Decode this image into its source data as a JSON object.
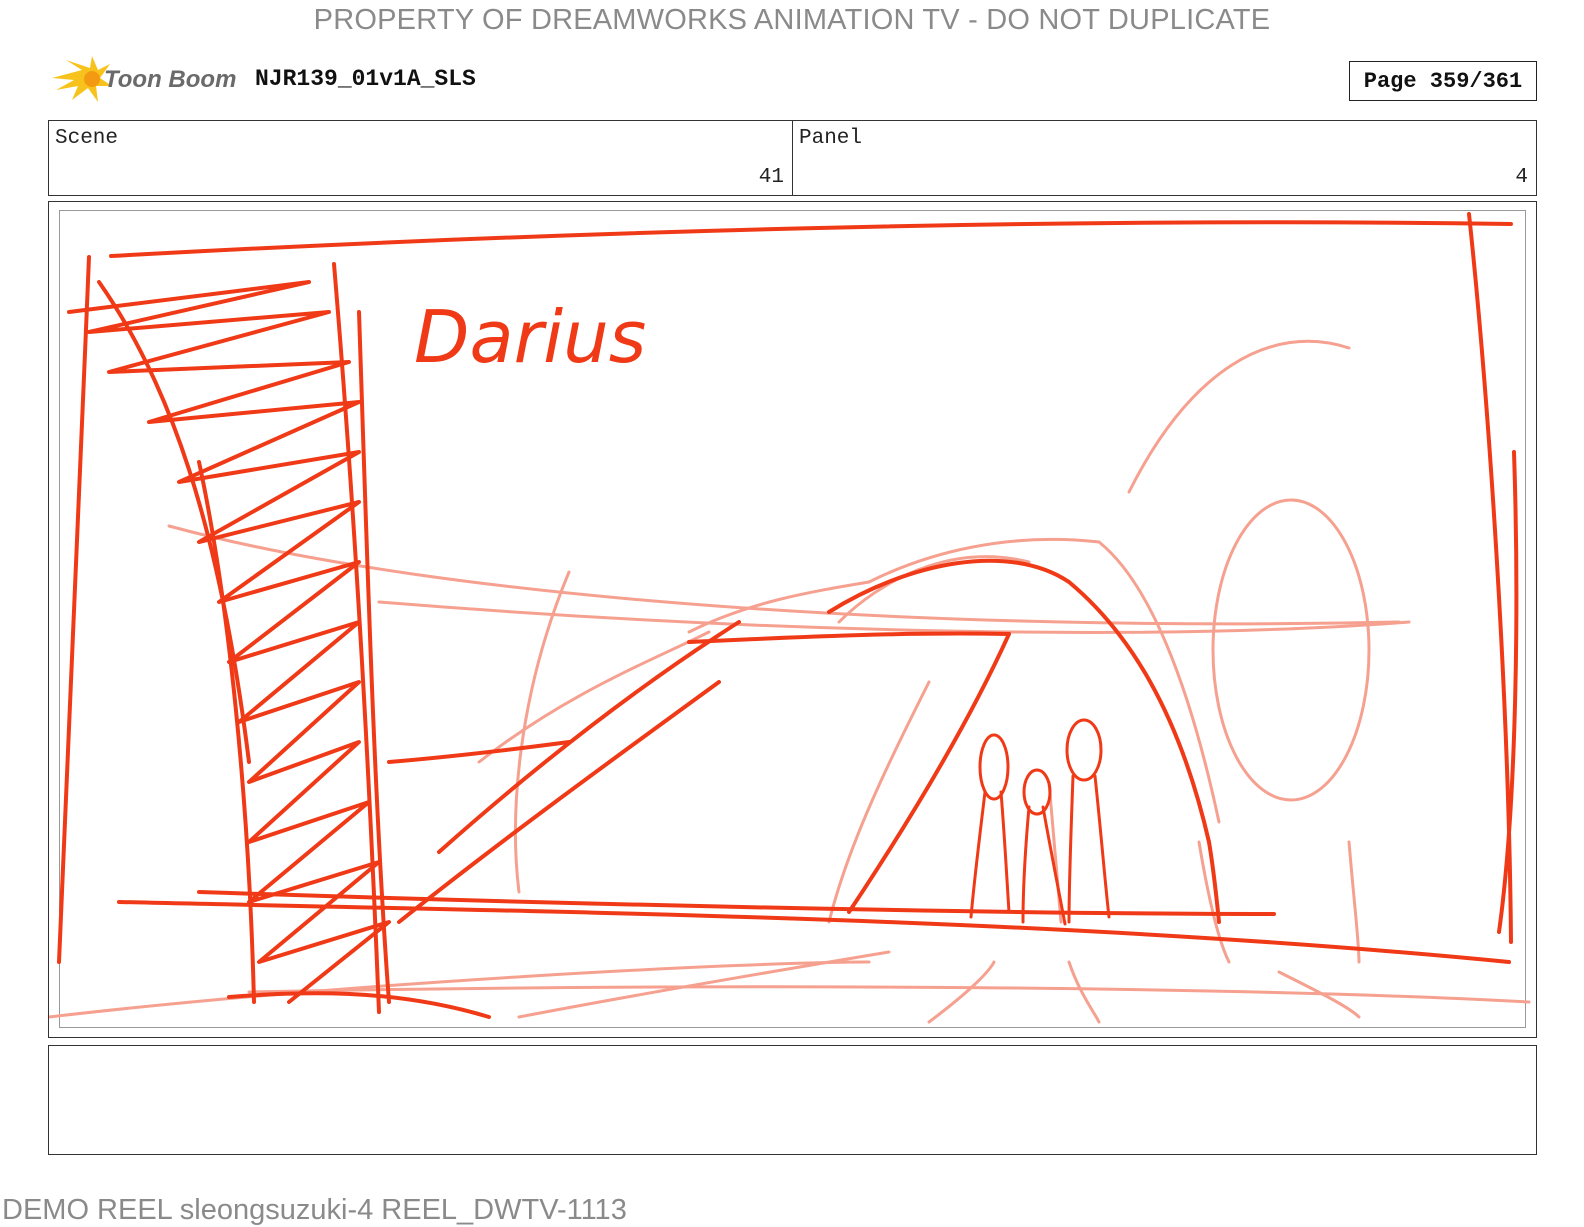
{
  "watermark": "PROPERTY OF DREAMWORKS ANIMATION TV - DO NOT DUPLICATE",
  "header": {
    "logo_text": "Toon Boom",
    "document_id": "NJR139_01v1A_SLS",
    "page_label": "Page 359/361"
  },
  "info": {
    "scene_label": "Scene",
    "scene_value": "41",
    "panel_label": "Panel",
    "panel_value": "4"
  },
  "sketch": {
    "annotation": "Darius",
    "stroke_color": "#f03a17",
    "light_stroke_color": "#f6a090"
  },
  "footer": "DEMO REEL sleongsuzuki-4 REEL_DWTV-1113"
}
